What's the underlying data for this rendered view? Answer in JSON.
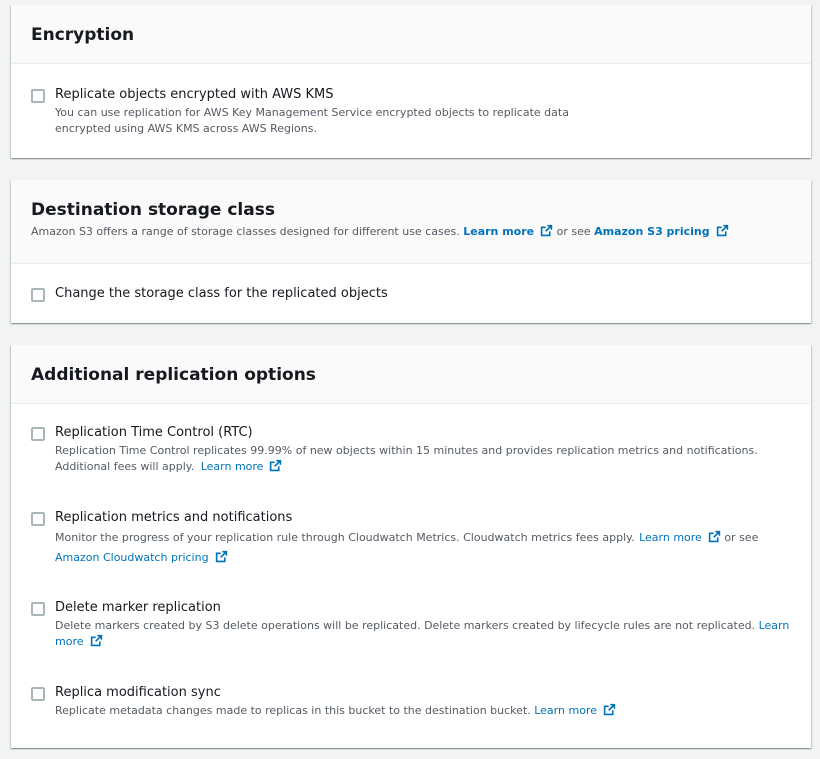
{
  "encryption": {
    "title": "Encryption",
    "option": {
      "label": "Replicate objects encrypted with AWS KMS",
      "desc1": "You can use replication for AWS Key Management Service encrypted objects to replicate data",
      "desc2": "encrypted using AWS KMS across AWS Regions."
    }
  },
  "storage_class": {
    "title": "Destination storage class",
    "desc_prefix": "Amazon S3 offers a range of storage classes designed for different use cases.",
    "learn_more": "Learn more",
    "or_see": "or see",
    "pricing_link": "Amazon S3 pricing",
    "option": {
      "label": "Change the storage class for the replicated objects"
    }
  },
  "additional": {
    "title": "Additional replication options",
    "rtc": {
      "label": "Replication Time Control (RTC)",
      "desc1": "Replication Time Control replicates 99.99% of new objects within 15 minutes and provides replication metrics and notifications.",
      "desc2": "Additional fees will apply.",
      "learn_more": "Learn more"
    },
    "metrics": {
      "label": "Replication metrics and notifications",
      "desc1": "Monitor the progress of your replication rule through Cloudwatch Metrics. Cloudwatch metrics fees apply.",
      "learn_more": "Learn more",
      "or_see": "or see",
      "pricing_link": "Amazon Cloudwatch pricing"
    },
    "delete_marker": {
      "label": "Delete marker replication",
      "desc1": "Delete markers created by S3 delete operations will be replicated. Delete markers created by lifecycle rules are not replicated.",
      "learn_more_1": "Learn",
      "learn_more_2": "more"
    },
    "replica_sync": {
      "label": "Replica modification sync",
      "desc1": "Replicate metadata changes made to replicas in this bucket to the destination bucket.",
      "learn_more": "Learn more"
    }
  },
  "colors": {
    "link": "#0073bb",
    "text": "#16191f",
    "secondary_text": "#545b64",
    "checkbox_border": "#aab7b8"
  }
}
